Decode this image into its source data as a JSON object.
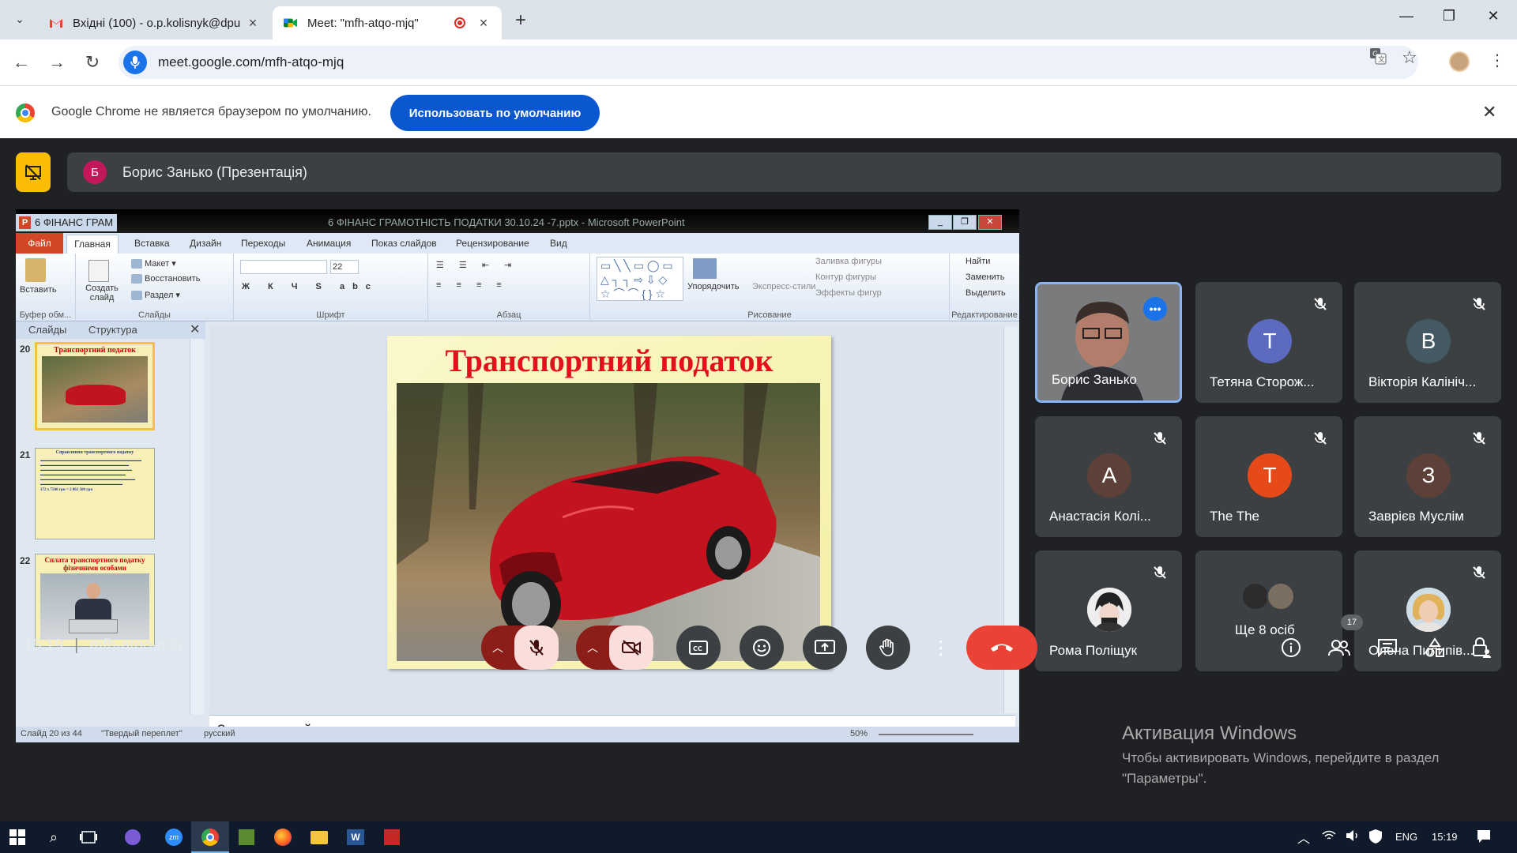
{
  "browser": {
    "tabs": [
      {
        "title": "Вхідні (100) - o.p.kolisnyk@dpu",
        "favicon": "gmail-icon"
      },
      {
        "title": "Meet: \"mfh-atqo-mjq\"",
        "favicon": "meet-icon"
      }
    ],
    "url": "meet.google.com/mfh-atqo-mjq"
  },
  "infobar": {
    "text": "Google Chrome не является браузером по умолчанию.",
    "button": "Использовать по умолчанию"
  },
  "presenter": {
    "initial": "Б",
    "label": "Борис Занько (Презентація)"
  },
  "powerpoint": {
    "app_tab": "6 ФІНАНС ГРАМ",
    "document_title": "6 ФІНАНС ГРАМОТНІСТЬ ПОДАТКИ 30.10.24 -7.pptx - Microsoft PowerPoint",
    "ribbon_tabs": [
      "Файл",
      "Главная",
      "Вставка",
      "Дизайн",
      "Переходы",
      "Анимация",
      "Показ слайдов",
      "Рецензирование",
      "Вид"
    ],
    "groups": {
      "clipboard": "Буфер обм...",
      "slides": "Слайды",
      "font": "Шрифт",
      "paragraph": "Абзац",
      "drawing": "Рисование",
      "editing": "Редактирование"
    },
    "buttons": {
      "paste": "Вставить",
      "new_slide": "Создать слайд",
      "layout": "Макет",
      "reset": "Восстановить",
      "section": "Раздел",
      "arrange": "Упорядочить",
      "quick_styles": "Экспресс-стили",
      "shape_fill": "Заливка фигуры",
      "shape_outline": "Контур фигуры",
      "shape_effects": "Эффекты фигур",
      "find": "Найти",
      "replace": "Заменить",
      "select": "Выделить",
      "font_size": "22"
    },
    "panel_tabs": [
      "Слайды",
      "Структура"
    ],
    "thumbnails": [
      {
        "num": "20",
        "title": "Транспортний податок"
      },
      {
        "num": "21",
        "title": "Справляння транспортного податку"
      },
      {
        "num": "22",
        "title": "Сплата транспортного податку фізичними особами"
      }
    ],
    "thumb21_last": "372 x 7500 грн = 2 862 500 грн",
    "slide_title": "Транспортний податок",
    "notes_placeholder": "Заметки к слайду",
    "status": {
      "slide": "Слайд 20 из 44",
      "theme": "\"Твердый переплет\"",
      "language": "русский",
      "zoom": "50%"
    }
  },
  "participants": [
    {
      "name": "Борис Занько",
      "type": "video",
      "speaking": true
    },
    {
      "name": "Тетяна Сторож...",
      "initial": "T",
      "color": "#5c6bc0",
      "muted": true
    },
    {
      "name": "Вікторія Калініч...",
      "initial": "B",
      "color": "#455a64",
      "muted": true
    },
    {
      "name": "Анастасія Колі...",
      "initial": "A",
      "color": "#5d4037",
      "muted": true
    },
    {
      "name": "The The",
      "initial": "T",
      "color": "#e64a19",
      "muted": true
    },
    {
      "name": "Заврієв Муслім",
      "initial": "З",
      "color": "#5d4037",
      "muted": true
    },
    {
      "name": "Рома Поліщук",
      "type": "image",
      "muted": true
    },
    {
      "name": "Ще 8 осіб",
      "type": "group"
    },
    {
      "name": "Олена Пилипів...",
      "type": "photo",
      "muted": true
    }
  ],
  "activation": {
    "title": "Активация Windows",
    "line1": "Чтобы активировать Windows, перейдите в раздел",
    "line2": "\"Параметры\"."
  },
  "meeting": {
    "time": "15:19",
    "code": "mfh-atqo-mjq",
    "people_count": "17"
  },
  "taskbar": {
    "lang": "ENG",
    "time": "15:19"
  }
}
